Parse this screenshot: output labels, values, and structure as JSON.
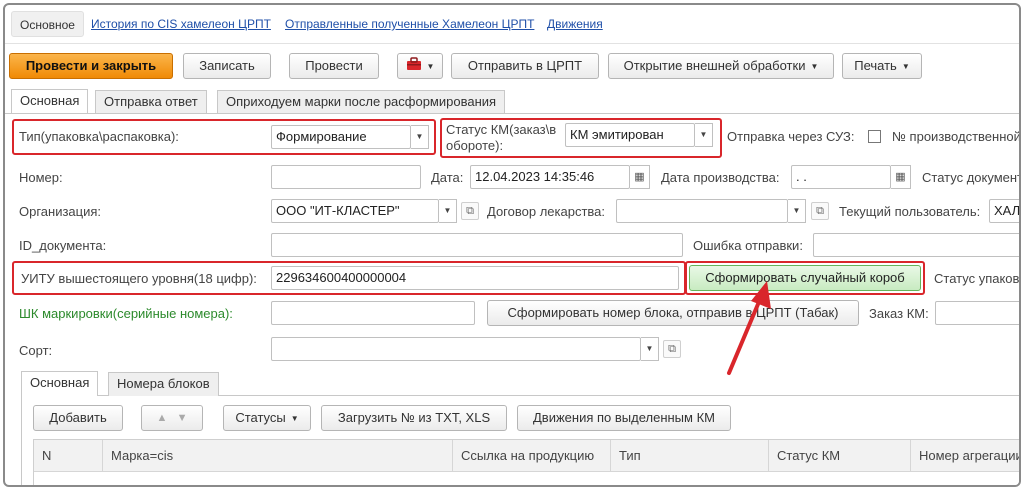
{
  "topnav": {
    "active": "Основное",
    "links": [
      "История по CIS хамелеон ЦРПТ",
      "Отправленные полученные Хамелеон ЦРПТ",
      "Движения"
    ]
  },
  "toolbar": {
    "post_close": "Провести и закрыть",
    "save": "Записать",
    "post": "Провести",
    "send": "Отправить в ЦРПТ",
    "open_ext": "Открытие внешней обработки",
    "print": "Печать"
  },
  "tabs": [
    "Основная",
    "Отправка ответ",
    "Оприходуем марки после расформирования"
  ],
  "form": {
    "type_label": "Тип(упаковка\\распаковка):",
    "type_value": "Формирование",
    "km_status_label_1": "Статус КМ(заказ\\в",
    "km_status_label_2": "обороте):",
    "km_status_value": "КМ эмитирован",
    "send_suz_label": "Отправка через СУЗ:",
    "prod_no_label": "№ производственной",
    "number_label": "Номер:",
    "number_value": "",
    "date_label": "Дата:",
    "date_value": "12.04.2023 14:35:46",
    "prod_date_label": "Дата производства:",
    "prod_date_value": " .  .",
    "doc_status_label": "Статус документ",
    "org_label": "Организация:",
    "org_value": "ООО \"ИТ-КЛАСТЕР\"",
    "contract_label": "Договор лекарства:",
    "contract_value": "",
    "user_label": "Текущий пользователь:",
    "user_value": "ХАЛИ",
    "doc_id_label": "ID_документа:",
    "doc_id_value": "",
    "send_error_label": "Ошибка отправки:",
    "send_error_value": "",
    "uitu_label": "УИТУ вышестоящего уровня(18 цифр):",
    "uitu_value": "229634600400000004",
    "random_box_btn": "Сформировать случайный короб",
    "pack_status_label": "Статус упаков",
    "shk_label": "ШК маркировки(серийные номера):",
    "shk_value": "",
    "block_btn": "Сформировать номер блока, отправив в ЦРПТ (Табак)",
    "order_km_label": "Заказ КМ:",
    "sort_label": "Сорт:",
    "sort_value": ""
  },
  "subtabs": [
    "Основная",
    "Номера блоков"
  ],
  "subtoolbar": {
    "add": "Добавить",
    "statuses": "Статусы",
    "load": "Загрузить № из TXT, XLS",
    "movements": "Движения по выделенным КМ"
  },
  "table": {
    "columns": [
      "N",
      "Марка=cis",
      "Ссылка на продукцию",
      "Тип",
      "Статус КМ",
      "Номер агрегации"
    ]
  },
  "colors": {
    "annotation_red": "#d9262b",
    "primary_orange": "#f08a05",
    "link_blue": "#1f4fa8"
  }
}
